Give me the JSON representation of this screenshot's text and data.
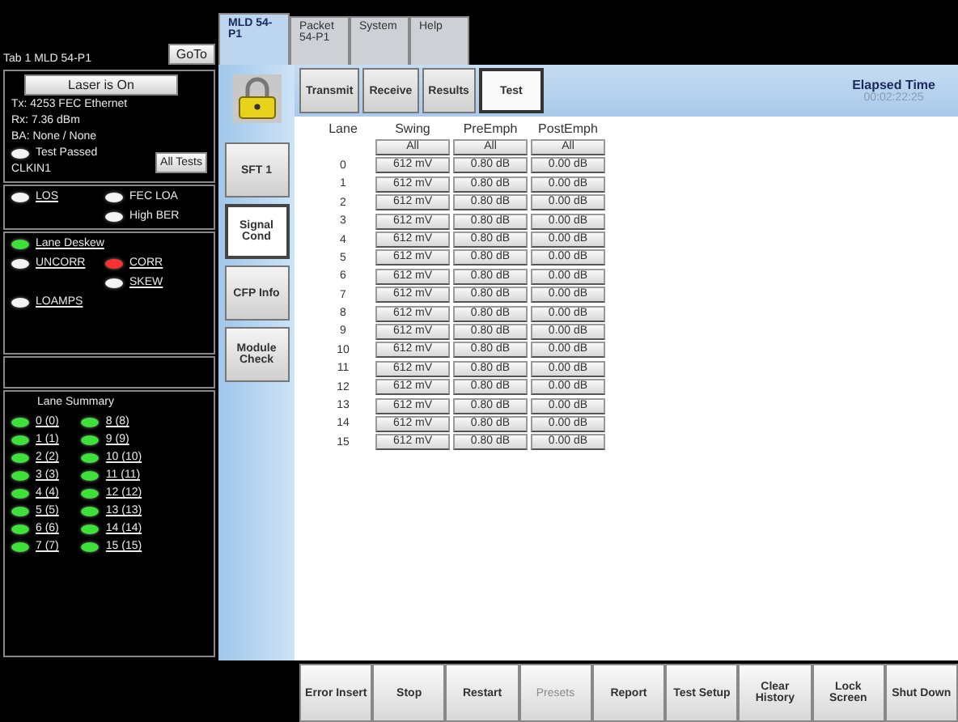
{
  "left_panel": {
    "tab_label": "Tab 1 MLD 54-P1",
    "goto_button": "GoTo",
    "laser_button": "Laser is On",
    "info_lines": [
      "Tx: 4253 FEC Ethernet",
      "Rx: 7.36 dBm",
      "BA: None / None"
    ],
    "test_status": {
      "label": "Test Passed",
      "color": "#f4f4f4"
    },
    "clock_line": "CLKIN1",
    "all_tests_button": "All Tests",
    "alarm_rows": [
      {
        "left": {
          "label": "LOS",
          "color": "#f4f4f4"
        },
        "right": {
          "label": "FEC LOA",
          "color": "#f4f4f4"
        }
      },
      {
        "right": {
          "label": "High BER",
          "color": "#f4f4f4"
        }
      }
    ],
    "lane_alarm_rows": [
      {
        "left": {
          "label": "Lane Deskew",
          "color": "#3ee03a"
        }
      },
      {
        "left": {
          "label": "UNCORR",
          "color": "#f4f4f4"
        },
        "right": {
          "label": "CORR",
          "color": "#ff3030"
        }
      },
      {
        "right": {
          "label": "SKEW",
          "color": "#f4f4f4"
        }
      },
      {
        "left": {
          "label": "LOAMPS",
          "color": "#f4f4f4"
        }
      }
    ],
    "lane_summary": {
      "title": "Lane Summary",
      "lanes": [
        {
          "label": "0 (0)",
          "color": "#3ee03a"
        },
        {
          "label": "1 (1)",
          "color": "#3ee03a"
        },
        {
          "label": "2 (2)",
          "color": "#3ee03a"
        },
        {
          "label": "3 (3)",
          "color": "#3ee03a"
        },
        {
          "label": "4 (4)",
          "color": "#3ee03a"
        },
        {
          "label": "5 (5)",
          "color": "#3ee03a"
        },
        {
          "label": "6 (6)",
          "color": "#3ee03a"
        },
        {
          "label": "7 (7)",
          "color": "#3ee03a"
        },
        {
          "label": "8 (8)",
          "color": "#3ee03a"
        },
        {
          "label": "9 (9)",
          "color": "#3ee03a"
        },
        {
          "label": "10 (10)",
          "color": "#3ee03a"
        },
        {
          "label": "11 (11)",
          "color": "#3ee03a"
        },
        {
          "label": "12 (12)",
          "color": "#3ee03a"
        },
        {
          "label": "13 (13)",
          "color": "#3ee03a"
        },
        {
          "label": "14 (14)",
          "color": "#3ee03a"
        },
        {
          "label": "15 (15)",
          "color": "#3ee03a"
        }
      ]
    }
  },
  "tabs": [
    {
      "label": "MLD 54-P1",
      "selected": true
    },
    {
      "label": "Packet 54-P1",
      "selected": false
    },
    {
      "label": "System",
      "selected": false
    },
    {
      "label": "Help",
      "selected": false
    }
  ],
  "side_buttons": [
    {
      "label": "SFT 1",
      "selected": false
    },
    {
      "label": "Signal Cond",
      "selected": true
    },
    {
      "label": "CFP Info",
      "selected": false
    },
    {
      "label": "Module Check",
      "selected": false
    }
  ],
  "sub_tabs": [
    {
      "label": "Transmit",
      "selected": false
    },
    {
      "label": "Receive",
      "selected": false
    },
    {
      "label": "Results",
      "selected": false
    },
    {
      "label": "Test",
      "selected": true
    }
  ],
  "elapsed": {
    "label": "Elapsed Time",
    "value": "00:02:22:25"
  },
  "table": {
    "columns": [
      "Lane",
      "Swing",
      "PreEmph",
      "PostEmph"
    ],
    "all_buttons": [
      "All",
      "All",
      "All"
    ],
    "rows": [
      [
        "0",
        "612 mV",
        "0.80 dB",
        "0.00 dB"
      ],
      [
        "1",
        "612 mV",
        "0.80 dB",
        "0.00 dB"
      ],
      [
        "2",
        "612 mV",
        "0.80 dB",
        "0.00 dB"
      ],
      [
        "3",
        "612 mV",
        "0.80 dB",
        "0.00 dB"
      ],
      [
        "4",
        "612 mV",
        "0.80 dB",
        "0.00 dB"
      ],
      [
        "5",
        "612 mV",
        "0.80 dB",
        "0.00 dB"
      ],
      [
        "6",
        "612 mV",
        "0.80 dB",
        "0.00 dB"
      ],
      [
        "7",
        "612 mV",
        "0.80 dB",
        "0.00 dB"
      ],
      [
        "8",
        "612 mV",
        "0.80 dB",
        "0.00 dB"
      ],
      [
        "9",
        "612 mV",
        "0.80 dB",
        "0.00 dB"
      ],
      [
        "10",
        "612 mV",
        "0.80 dB",
        "0.00 dB"
      ],
      [
        "11",
        "612 mV",
        "0.80 dB",
        "0.00 dB"
      ],
      [
        "12",
        "612 mV",
        "0.80 dB",
        "0.00 dB"
      ],
      [
        "13",
        "612 mV",
        "0.80 dB",
        "0.00 dB"
      ],
      [
        "14",
        "612 mV",
        "0.80 dB",
        "0.00 dB"
      ],
      [
        "15",
        "612 mV",
        "0.80 dB",
        "0.00 dB"
      ]
    ]
  },
  "bottom_buttons": [
    {
      "label": "Error Insert",
      "disabled": false
    },
    {
      "label": "Stop",
      "disabled": false
    },
    {
      "label": "Restart",
      "disabled": false
    },
    {
      "label": "Presets",
      "disabled": true
    },
    {
      "label": "Report",
      "disabled": false
    },
    {
      "label": "Test Setup",
      "disabled": false
    },
    {
      "label": "Clear History",
      "disabled": false
    },
    {
      "label": "Lock Screen",
      "disabled": false
    },
    {
      "label": "Shut Down",
      "disabled": false
    }
  ]
}
